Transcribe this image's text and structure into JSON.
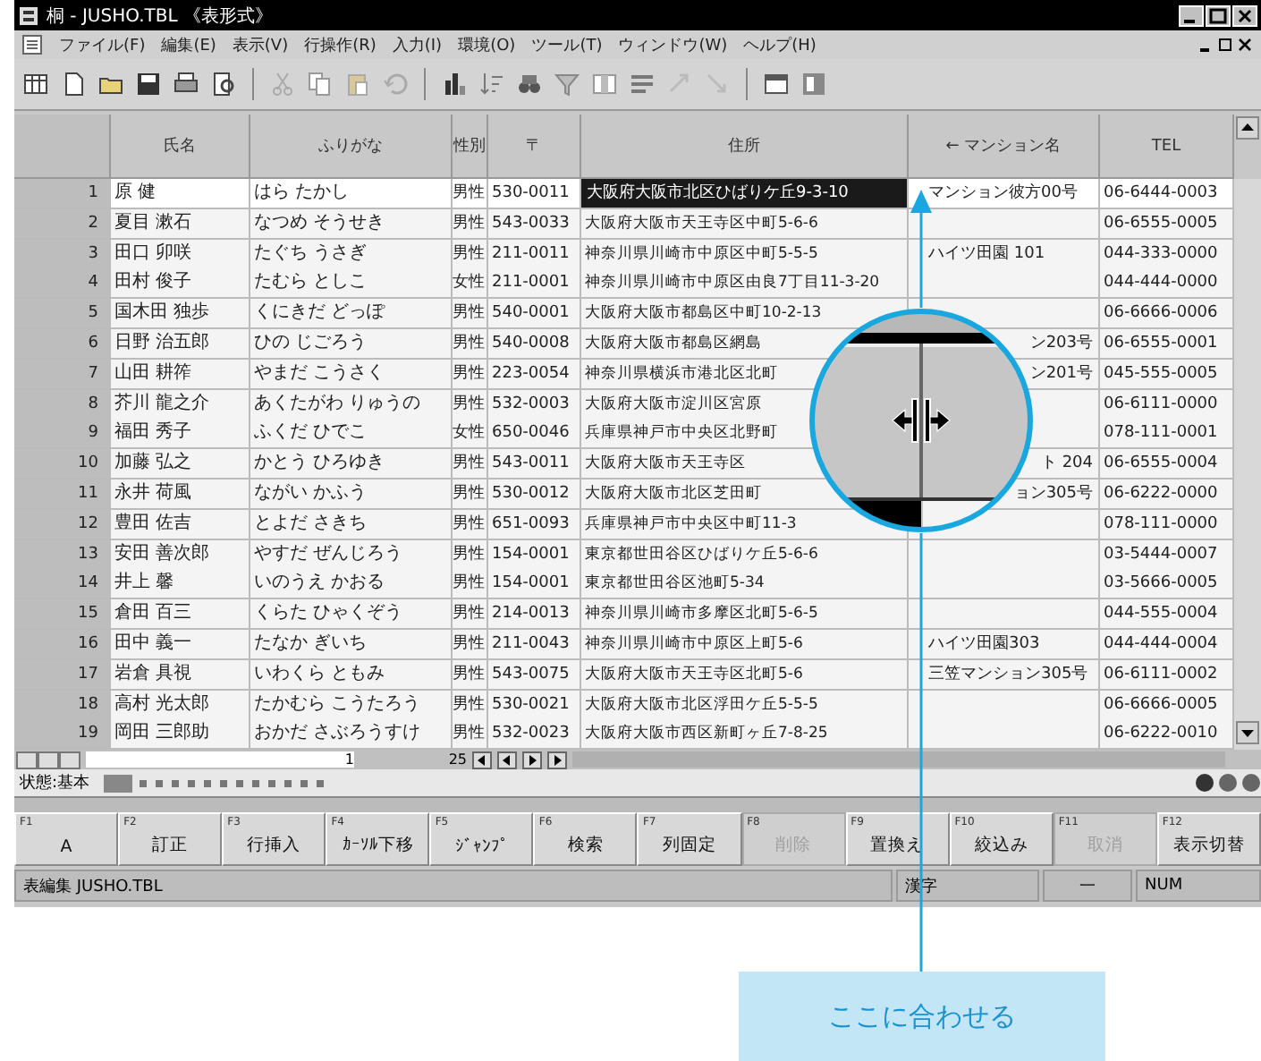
{
  "window": {
    "title": "桐 - JUSHO.TBL 《表形式》"
  },
  "menu": [
    "ファイル(F)",
    "編集(E)",
    "表示(V)",
    "行操作(R)",
    "入力(I)",
    "環境(O)",
    "ツール(T)",
    "ウィンドウ(W)",
    "ヘルプ(H)"
  ],
  "table": {
    "columns": [
      "氏名",
      "ふりがな",
      "性別",
      "〒",
      "住所",
      "← マンション名",
      "TEL"
    ],
    "rows": [
      {
        "no": "1",
        "name": "原 健",
        "kana": "はら たかし",
        "sex": "男性",
        "zip": "530-0011",
        "address": "大阪府大阪市北区ひばりケ丘9-3-10",
        "mansion": {
          "text": "マンション彼方00号",
          "cut": false
        },
        "tel": "06-6444-0003",
        "selected": true
      },
      {
        "no": "2",
        "name": "夏目 漱石",
        "kana": "なつめ そうせき",
        "sex": "男性",
        "zip": "543-0033",
        "address": "大阪府大阪市天王寺区中町5-6-6",
        "tel": "06-6555-0005",
        "selected": false
      },
      {
        "no": "3",
        "name": "田口 卯咲",
        "kana": "たぐち うさぎ",
        "sex": "男性",
        "zip": "211-0011",
        "address": "神奈川県川崎市中原区中町5-5-5",
        "mansion": {
          "text": "ハイツ田園 101",
          "cut": false
        },
        "tel": "044-333-0000",
        "selected": false
      },
      {
        "no": "4",
        "name": "田村 俊子",
        "kana": "たむら としこ",
        "sex": "女性",
        "zip": "211-0001",
        "address": "神奈川県川崎市中原区由良7丁目11-3-20",
        "tel": "044-444-0000",
        "selected": false
      },
      {
        "no": "5",
        "name": "国木田 独歩",
        "kana": "くにきだ どっぽ",
        "sex": "男性",
        "zip": "540-0001",
        "address": "大阪府大阪市都島区中町10-2-13",
        "tel": "06-6666-0006",
        "selected": false
      },
      {
        "no": "6",
        "name": "日野 治五郎",
        "kana": "ひの じごろう",
        "sex": "男性",
        "zip": "540-0008",
        "address": "大阪府大阪市都島区網島",
        "mansion": {
          "text": "ン203号",
          "cut": true
        },
        "tel": "06-6555-0001",
        "selected": false
      },
      {
        "no": "7",
        "name": "山田 耕筰",
        "kana": "やまだ こうさく",
        "sex": "男性",
        "zip": "223-0054",
        "address": "神奈川県横浜市港北区北町",
        "mansion": {
          "text": "ン201号",
          "cut": true
        },
        "tel": "045-555-0005",
        "selected": false
      },
      {
        "no": "8",
        "name": "芥川 龍之介",
        "kana": "あくたがわ りゅうの",
        "sex": "男性",
        "zip": "532-0003",
        "address": "大阪府大阪市淀川区宮原",
        "tel": "06-6111-0000",
        "selected": false
      },
      {
        "no": "9",
        "name": "福田 秀子",
        "kana": "ふくだ ひでこ",
        "sex": "女性",
        "zip": "650-0046",
        "address": "兵庫県神戸市中央区北野町",
        "tel": "078-111-0001",
        "selected": false
      },
      {
        "no": "10",
        "name": "加藤 弘之",
        "kana": "かとう ひろゆき",
        "sex": "男性",
        "zip": "543-0011",
        "address": "大阪府大阪市天王寺区",
        "mansion": {
          "text": "ト 204",
          "cut": true
        },
        "tel": "06-6555-0004",
        "selected": false
      },
      {
        "no": "11",
        "name": "永井 荷風",
        "kana": "ながい かふう",
        "sex": "男性",
        "zip": "530-0012",
        "address": "大阪府大阪市北区芝田町",
        "mansion": {
          "text": "ョン305号",
          "cut": true
        },
        "tel": "06-6222-0000",
        "selected": false
      },
      {
        "no": "12",
        "name": "豊田 佐吉",
        "kana": "とよだ さきち",
        "sex": "男性",
        "zip": "651-0093",
        "address": "兵庫県神戸市中央区中町11-3",
        "tel": "078-111-0000",
        "selected": false
      },
      {
        "no": "13",
        "name": "安田 善次郎",
        "kana": "やすだ ぜんじろう",
        "sex": "男性",
        "zip": "154-0001",
        "address": "東京都世田谷区ひばりケ丘5-6-6",
        "tel": "03-5444-0007",
        "selected": false
      },
      {
        "no": "14",
        "name": "井上 馨",
        "kana": "いのうえ かおる",
        "sex": "男性",
        "zip": "154-0001",
        "address": "東京都世田谷区池町5-34",
        "tel": "03-5666-0005",
        "selected": false
      },
      {
        "no": "15",
        "name": "倉田 百三",
        "kana": "くらた ひゃくぞう",
        "sex": "男性",
        "zip": "214-0013",
        "address": "神奈川県川崎市多摩区北町5-6-5",
        "tel": "044-555-0004",
        "selected": false
      },
      {
        "no": "16",
        "name": "田中 義一",
        "kana": "たなか ぎいち",
        "sex": "男性",
        "zip": "211-0043",
        "address": "神奈川県川崎市中原区上町5-6",
        "mansion": {
          "text": "ハイツ田園303",
          "cut": false
        },
        "tel": "044-444-0004",
        "selected": false
      },
      {
        "no": "17",
        "name": "岩倉 具視",
        "kana": "いわくら ともみ",
        "sex": "男性",
        "zip": "543-0075",
        "address": "大阪府大阪市天王寺区北町5-6",
        "mansion": {
          "text": "三笠マンション305号",
          "cut": false
        },
        "tel": "06-6111-0002",
        "selected": false
      },
      {
        "no": "18",
        "name": "高村 光太郎",
        "kana": "たかむら こうたろう",
        "sex": "男性",
        "zip": "530-0021",
        "address": "大阪府大阪市北区浮田ケ丘5-5-5",
        "tel": "06-6666-0005",
        "selected": false
      },
      {
        "no": "19",
        "name": "岡田 三郎助",
        "kana": "おかだ さぶろうすけ",
        "sex": "男性",
        "zip": "532-0023",
        "address": "大阪府大阪市西区新町ヶ丘7-8-25",
        "tel": "06-6222-0010",
        "selected": false
      }
    ]
  },
  "pager": {
    "current": "1",
    "total": "25"
  },
  "state_line": {
    "text": "状態:基本"
  },
  "function_keys": [
    {
      "key": "F1",
      "label": "A",
      "disabled": false
    },
    {
      "key": "F2",
      "label": "訂正",
      "disabled": false
    },
    {
      "key": "F3",
      "label": "行挿入",
      "disabled": false
    },
    {
      "key": "F4",
      "label": "ｶｰｿﾙ下移",
      "disabled": false
    },
    {
      "key": "F5",
      "label": "ｼﾞｬﾝﾌﾟ",
      "disabled": false
    },
    {
      "key": "F6",
      "label": "検索",
      "disabled": false
    },
    {
      "key": "F7",
      "label": "列固定",
      "disabled": false
    },
    {
      "key": "F8",
      "label": "削除",
      "disabled": true
    },
    {
      "key": "F9",
      "label": "置換え",
      "disabled": false
    },
    {
      "key": "F10",
      "label": "絞込み",
      "disabled": false
    },
    {
      "key": "F11",
      "label": "取消",
      "disabled": true
    },
    {
      "key": "F12",
      "label": "表示切替",
      "disabled": false
    }
  ],
  "status_bar": [
    "表編集 JUSHO.TBL",
    "漢字",
    "一",
    "NUM"
  ],
  "callout": {
    "text": "ここに合わせる"
  }
}
